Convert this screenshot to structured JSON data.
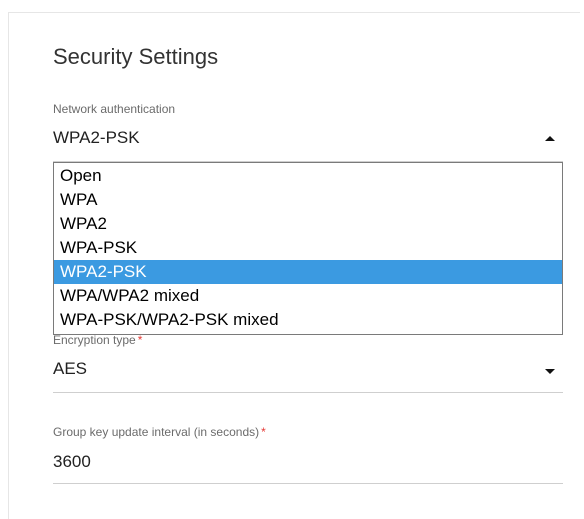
{
  "section": {
    "title": "Security Settings"
  },
  "auth": {
    "label": "Network authentication",
    "value": "WPA2-PSK",
    "options": [
      "Open",
      "WPA",
      "WPA2",
      "WPA-PSK",
      "WPA2-PSK",
      "WPA/WPA2 mixed",
      "WPA-PSK/WPA2-PSK mixed"
    ],
    "selected_index": 4
  },
  "encryption": {
    "label": "Encryption type",
    "required_mark": "*",
    "value": "AES"
  },
  "group_key": {
    "label": "Group key update interval (in seconds)",
    "required_mark": "*",
    "value": "3600"
  },
  "colors": {
    "selected_option_bg": "#3b9ae1",
    "required_mark": "#e53935"
  }
}
